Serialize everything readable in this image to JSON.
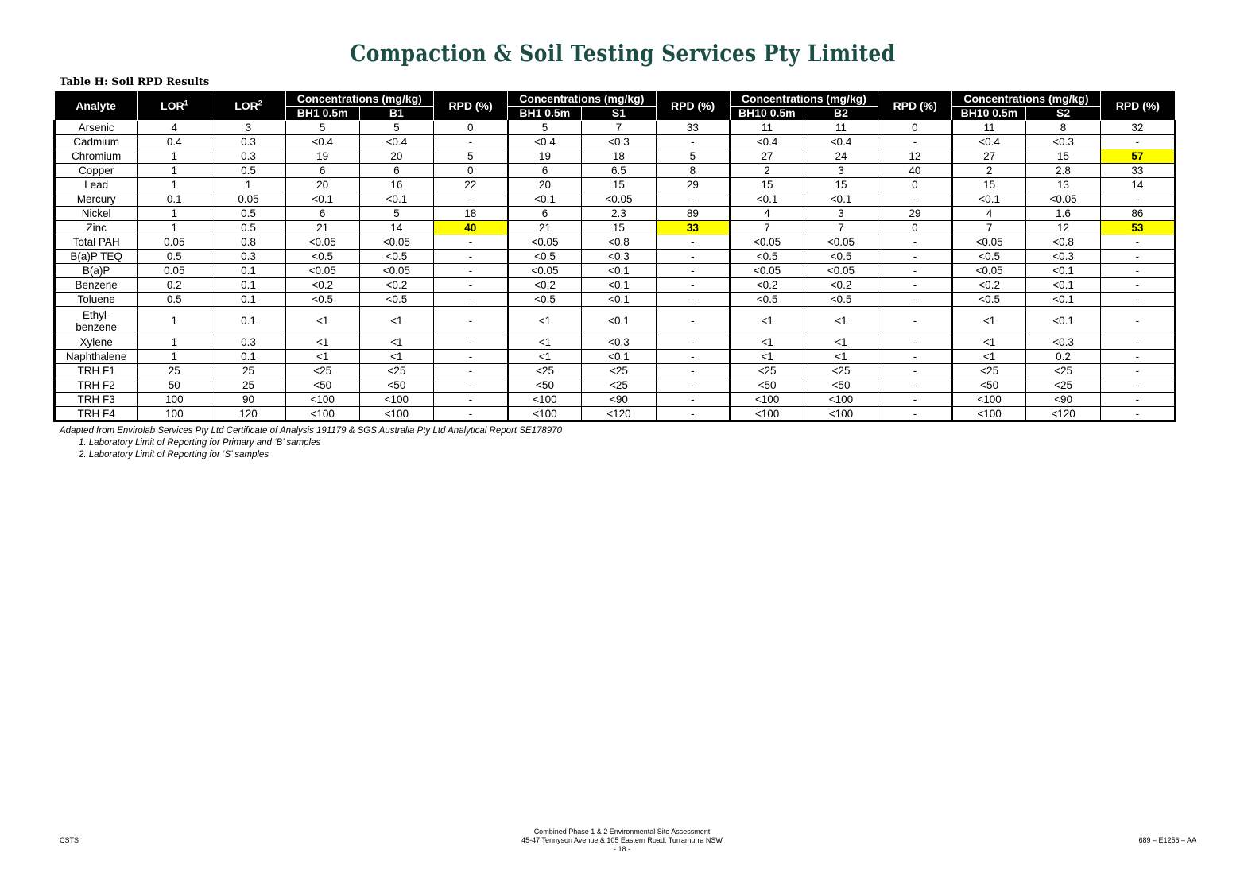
{
  "header": {
    "company": "Compaction & Soil Testing Services Pty Limited",
    "table_title": "Table H: Soil RPD Results"
  },
  "table": {
    "col_analyte": "Analyte",
    "col_lor1": "LOR",
    "col_lor1_sup": "1",
    "col_lor2": "LOR",
    "col_lor2_sup": "2",
    "groups": [
      {
        "label": "Concentrations (mg/kg)",
        "a": "BH1 0.5m",
        "b": "B1",
        "rpd": "RPD (%)"
      },
      {
        "label": "Concentrations (mg/kg)",
        "a": "BH1 0.5m",
        "b": "S1",
        "rpd": "RPD (%)"
      },
      {
        "label": "Concentrations (mg/kg)",
        "a": "BH10 0.5m",
        "b": "B2",
        "rpd": "RPD (%)"
      },
      {
        "label": "Concentrations (mg/kg)",
        "a": "BH10 0.5m",
        "b": "S2",
        "rpd": "RPD (%)"
      }
    ],
    "highlight_color": "#ffff00",
    "rows": [
      {
        "cells": [
          "Arsenic",
          "4",
          "3",
          "5",
          "5",
          "0",
          "5",
          "7",
          "33",
          "11",
          "11",
          "0",
          "11",
          "8",
          "32"
        ],
        "hl": []
      },
      {
        "cells": [
          "Cadmium",
          "0.4",
          "0.3",
          "<0.4",
          "<0.4",
          "-",
          "<0.4",
          "<0.3",
          "-",
          "<0.4",
          "<0.4",
          "-",
          "<0.4",
          "<0.3",
          "-"
        ],
        "hl": []
      },
      {
        "cells": [
          "Chromium",
          "1",
          "0.3",
          "19",
          "20",
          "5",
          "19",
          "18",
          "5",
          "27",
          "24",
          "12",
          "27",
          "15",
          "57"
        ],
        "hl": [
          14
        ]
      },
      {
        "cells": [
          "Copper",
          "1",
          "0.5",
          "6",
          "6",
          "0",
          "6",
          "6.5",
          "8",
          "2",
          "3",
          "40",
          "2",
          "2.8",
          "33"
        ],
        "hl": []
      },
      {
        "cells": [
          "Lead",
          "1",
          "1",
          "20",
          "16",
          "22",
          "20",
          "15",
          "29",
          "15",
          "15",
          "0",
          "15",
          "13",
          "14"
        ],
        "hl": []
      },
      {
        "cells": [
          "Mercury",
          "0.1",
          "0.05",
          "<0.1",
          "<0.1",
          "-",
          "<0.1",
          "<0.05",
          "-",
          "<0.1",
          "<0.1",
          "-",
          "<0.1",
          "<0.05",
          "-"
        ],
        "hl": []
      },
      {
        "cells": [
          "Nickel",
          "1",
          "0.5",
          "6",
          "5",
          "18",
          "6",
          "2.3",
          "89",
          "4",
          "3",
          "29",
          "4",
          "1.6",
          "86"
        ],
        "hl": []
      },
      {
        "cells": [
          "Zinc",
          "1",
          "0.5",
          "21",
          "14",
          "40",
          "21",
          "15",
          "33",
          "7",
          "7",
          "0",
          "7",
          "12",
          "53"
        ],
        "hl": [
          5,
          8,
          14
        ]
      },
      {
        "cells": [
          "Total PAH",
          "0.05",
          "0.8",
          "<0.05",
          "<0.05",
          "-",
          "<0.05",
          "<0.8",
          "-",
          "<0.05",
          "<0.05",
          "-",
          "<0.05",
          "<0.8",
          "-"
        ],
        "hl": []
      },
      {
        "cells": [
          "B(a)P TEQ",
          "0.5",
          "0.3",
          "<0.5",
          "<0.5",
          "-",
          "<0.5",
          "<0.3",
          "-",
          "<0.5",
          "<0.5",
          "-",
          "<0.5",
          "<0.3",
          "-"
        ],
        "hl": []
      },
      {
        "cells": [
          "B(a)P",
          "0.05",
          "0.1",
          "<0.05",
          "<0.05",
          "-",
          "<0.05",
          "<0.1",
          "-",
          "<0.05",
          "<0.05",
          "-",
          "<0.05",
          "<0.1",
          "-"
        ],
        "hl": []
      },
      {
        "cells": [
          "Benzene",
          "0.2",
          "0.1",
          "<0.2",
          "<0.2",
          "-",
          "<0.2",
          "<0.1",
          "-",
          "<0.2",
          "<0.2",
          "-",
          "<0.2",
          "<0.1",
          "-"
        ],
        "hl": []
      },
      {
        "cells": [
          "Toluene",
          "0.5",
          "0.1",
          "<0.5",
          "<0.5",
          "-",
          "<0.5",
          "<0.1",
          "-",
          "<0.5",
          "<0.5",
          "-",
          "<0.5",
          "<0.1",
          "-"
        ],
        "hl": []
      },
      {
        "cells": [
          "Ethyl-\nbenzene",
          "1",
          "0.1",
          "<1",
          "<1",
          "-",
          "<1",
          "<0.1",
          "-",
          "<1",
          "<1",
          "-",
          "<1",
          "<0.1",
          "-"
        ],
        "hl": [],
        "tall": true
      },
      {
        "cells": [
          "Xylene",
          "1",
          "0.3",
          "<1",
          "<1",
          "-",
          "<1",
          "<0.3",
          "-",
          "<1",
          "<1",
          "-",
          "<1",
          "<0.3",
          "-"
        ],
        "hl": []
      },
      {
        "cells": [
          "Naphthalene",
          "1",
          "0.1",
          "<1",
          "<1",
          "-",
          "<1",
          "<0.1",
          "-",
          "<1",
          "<1",
          "-",
          "<1",
          "0.2",
          "-"
        ],
        "hl": []
      },
      {
        "cells": [
          "TRH F1",
          "25",
          "25",
          "<25",
          "<25",
          "-",
          "<25",
          "<25",
          "-",
          "<25",
          "<25",
          "-",
          "<25",
          "<25",
          "-"
        ],
        "hl": []
      },
      {
        "cells": [
          "TRH F2",
          "50",
          "25",
          "<50",
          "<50",
          "-",
          "<50",
          "<25",
          "-",
          "<50",
          "<50",
          "-",
          "<50",
          "<25",
          "-"
        ],
        "hl": []
      },
      {
        "cells": [
          "TRH F3",
          "100",
          "90",
          "<100",
          "<100",
          "-",
          "<100",
          "<90",
          "-",
          "<100",
          "<100",
          "-",
          "<100",
          "<90",
          "-"
        ],
        "hl": []
      },
      {
        "cells": [
          "TRH F4",
          "100",
          "120",
          "<100",
          "<100",
          "-",
          "<100",
          "<120",
          "-",
          "<100",
          "<100",
          "-",
          "<100",
          "<120",
          "-"
        ],
        "hl": []
      }
    ]
  },
  "notes": {
    "source": "Adapted from Envirolab Services Pty Ltd Certificate of Analysis 191179 & SGS Australia Pty Ltd Analytical Report SE178970",
    "fn1": "1.   Laboratory Limit of Reporting for Primary and ‘B’ samples",
    "fn2": "2.   Laboratory Limit of Reporting for ‘S’ samples"
  },
  "footer": {
    "left": "CSTS",
    "center_line1": "Combined Phase 1 & 2 Environmental Site Assessment",
    "center_line2": "45-47 Tennyson Avenue & 105 Eastern Road, Turramurra NSW",
    "center_line3": "- 18 -",
    "right": "689 – E1256 – AA"
  }
}
